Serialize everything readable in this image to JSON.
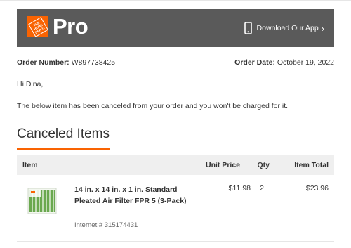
{
  "brand": {
    "logo_text": "THE HOME DEPOT",
    "product_name": "Pro",
    "accent_color": "#f96302",
    "header_bg": "#5a5a5a"
  },
  "header": {
    "app_link_label": "Download Our App",
    "app_link_icon": "phone-icon",
    "app_link_arrow": "›"
  },
  "order": {
    "number_label": "Order Number:",
    "number_value": "W897738425",
    "date_label": "Order Date:",
    "date_value": "October 19, 2022"
  },
  "greeting": "Hi Dina,",
  "message": "The below item has been canceled from your order and you won't be charged for it.",
  "section_title": "Canceled Items",
  "table": {
    "columns": [
      "Item",
      "Unit Price",
      "Qty",
      "Item Total"
    ],
    "rows": [
      {
        "name": "14 in. x 14 in. x 1 in. Standard Pleated Air Filter FPR 5 (3-Pack)",
        "internet_number": "Internet # 315174431",
        "unit_price": "$11.98",
        "qty": "2",
        "total": "$23.96"
      }
    ]
  }
}
